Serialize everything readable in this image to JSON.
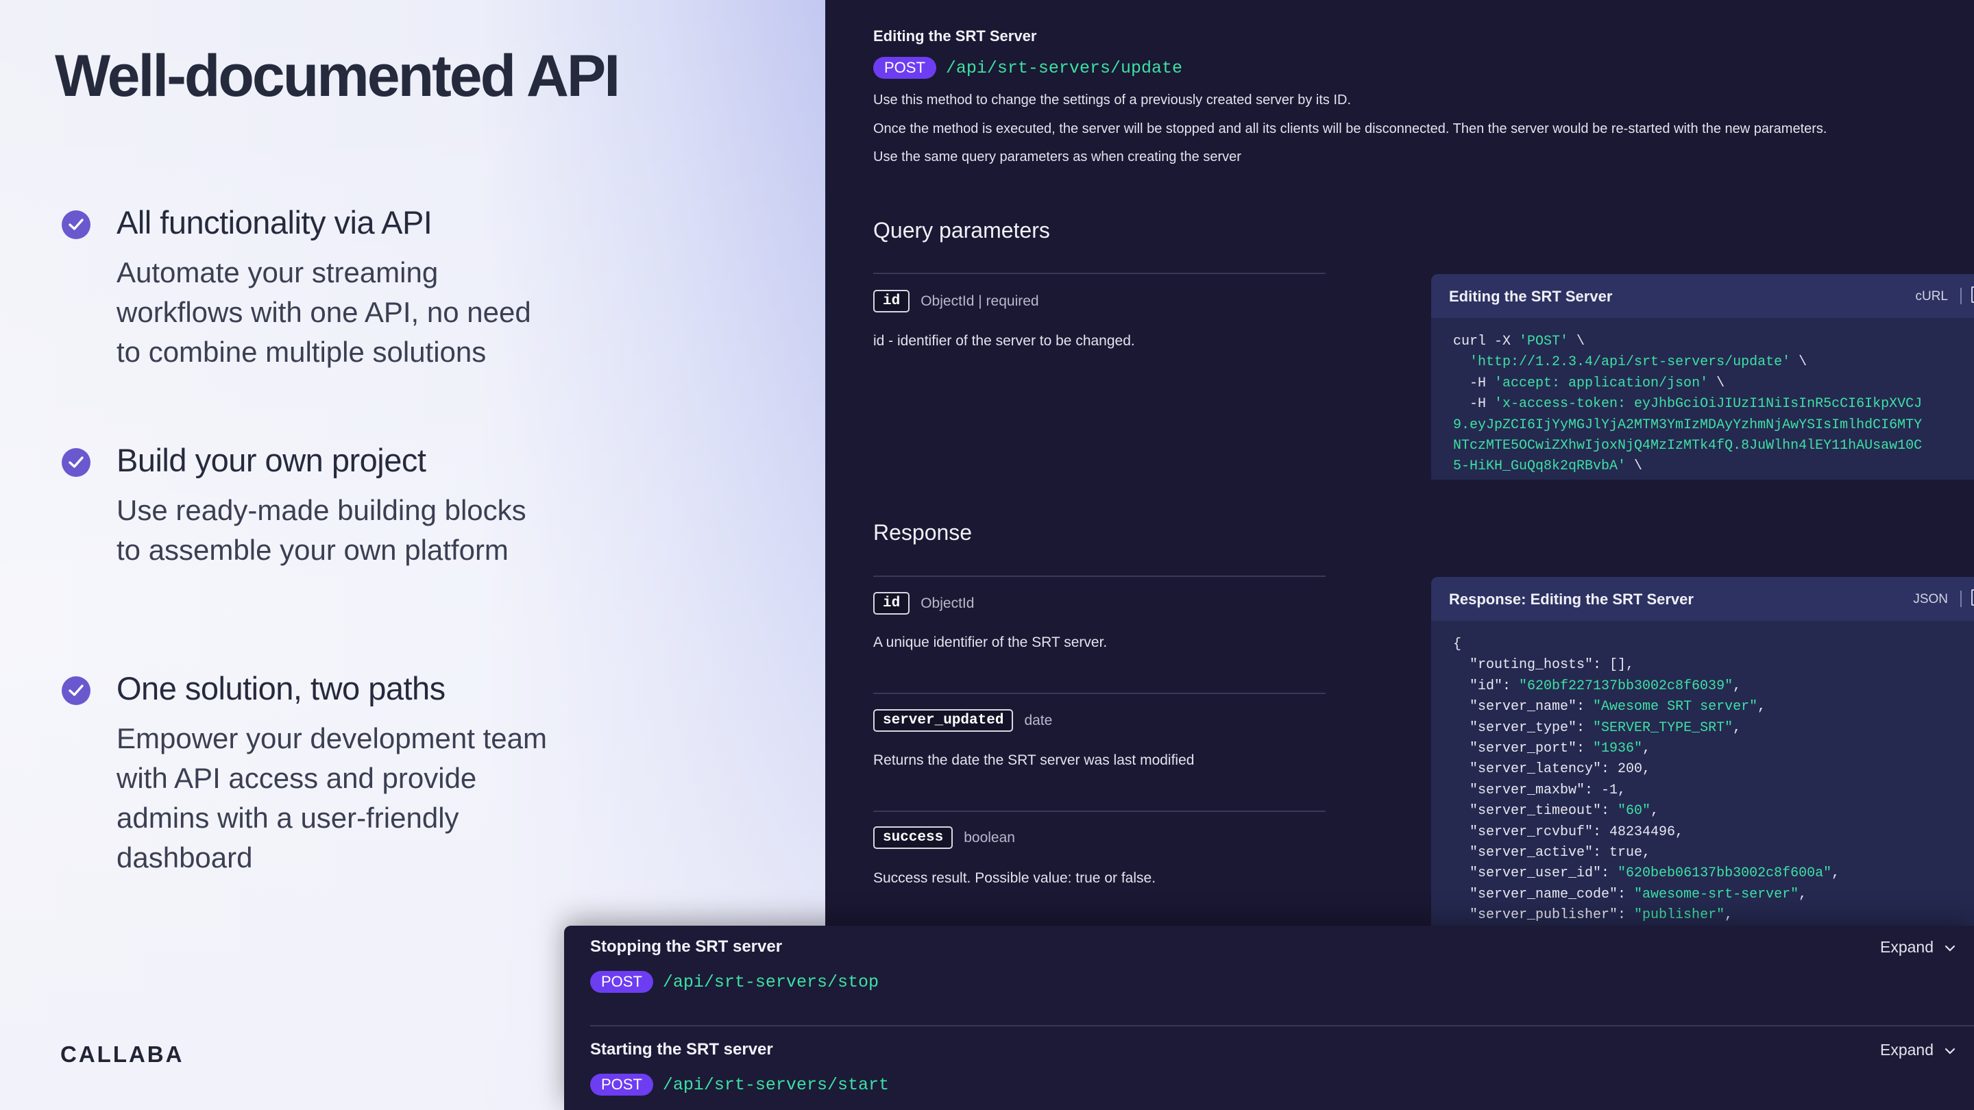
{
  "hero": {
    "title": "Well-documented API"
  },
  "features": [
    {
      "title": "All functionality via API",
      "lines": [
        "Automate your streaming",
        "workflows with one API, no need",
        "to combine multiple solutions"
      ]
    },
    {
      "title": "Build your own project",
      "lines": [
        "Use ready-made building blocks",
        "to assemble your own platform"
      ]
    },
    {
      "title": "One solution, two paths",
      "lines": [
        "Empower your development team",
        "with API access and provide",
        "admins with a user-friendly",
        "dashboard"
      ]
    }
  ],
  "brand": "CALLABA",
  "doc": {
    "title": "Editing the SRT Server",
    "method": "POST",
    "path": "/api/srt-servers/update",
    "paragraphs": [
      "Use this method to change the settings of a previously created server by its ID.",
      "Once the method is executed, the server will be stopped and all its clients will be disconnected. Then the server would be re-started with the new parameters.",
      "Use the same query parameters as when creating the server"
    ],
    "query_heading": "Query parameters",
    "query_params": [
      {
        "name": "id",
        "type": "ObjectId | required",
        "desc": "id - identifier of the server to be changed."
      }
    ],
    "response_heading": "Response",
    "response_params": [
      {
        "name": "id",
        "type": "ObjectId",
        "desc": "A unique identifier of the SRT server."
      },
      {
        "name": "server_updated",
        "type": "date",
        "desc": "Returns the date the SRT server was last modified"
      },
      {
        "name": "success",
        "type": "boolean",
        "desc": "Success result. Possible value: true or false."
      }
    ]
  },
  "curl_panel": {
    "title": "Editing the SRT Server",
    "format": "cURL",
    "lines": [
      {
        "k": "curl -X ",
        "s": "'POST'",
        "t": " \\"
      },
      {
        "k": "  ",
        "s": "'http://1.2.3.4/api/srt-servers/update'",
        "t": " \\"
      },
      {
        "k": "  -H ",
        "s": "'accept: application/json'",
        "t": " \\"
      },
      {
        "k": "  -H ",
        "s": "'x-access-token: eyJhbGciOiJIUzI1NiIsInR5cCI6IkpXVCJ",
        "t": ""
      },
      {
        "k": "",
        "s": "9.eyJpZCI6IjYyMGJlYjA2MTM3YmIzMDAyYzhmNjAwYSIsImlhdCI6MTY",
        "t": ""
      },
      {
        "k": "",
        "s": "NTczMTE5OCwiZXhwIjoxNjQ4MzIzMTk4fQ.8JuWlhn4lEY11hAUsaw10C",
        "t": ""
      },
      {
        "k": "",
        "s": "5-HiKH_GuQq8k2qRBvbA'",
        "t": " \\"
      }
    ]
  },
  "json_panel": {
    "title": "Response: Editing the SRT Server",
    "format": "JSON",
    "lines": [
      {
        "k": "{",
        "s": "",
        "t": ""
      },
      {
        "k": "  \"routing_hosts\": [],",
        "s": "",
        "t": ""
      },
      {
        "k": "  \"id\": ",
        "s": "\"620bf227137bb3002c8f6039\"",
        "t": ","
      },
      {
        "k": "  \"server_name\": ",
        "s": "\"Awesome SRT server\"",
        "t": ","
      },
      {
        "k": "  \"server_type\": ",
        "s": "\"SERVER_TYPE_SRT\"",
        "t": ","
      },
      {
        "k": "  \"server_port\": ",
        "s": "\"1936\"",
        "t": ","
      },
      {
        "k": "  \"server_latency\": 200,",
        "s": "",
        "t": ""
      },
      {
        "k": "  \"server_maxbw\": -1,",
        "s": "",
        "t": ""
      },
      {
        "k": "  \"server_timeout\": ",
        "s": "\"60\"",
        "t": ","
      },
      {
        "k": "  \"server_rcvbuf\": 48234496,",
        "s": "",
        "t": ""
      },
      {
        "k": "  \"server_active\": true,",
        "s": "",
        "t": ""
      },
      {
        "k": "  \"server_user_id\": ",
        "s": "\"620beb06137bb3002c8f600a\"",
        "t": ","
      },
      {
        "k": "  \"server_name_code\": ",
        "s": "\"awesome-srt-server\"",
        "t": ","
      },
      {
        "k": "  \"server_publisher\": ",
        "s": "\"publisher\"",
        "t": ","
      }
    ]
  },
  "endpoints": [
    {
      "title": "Stopping the SRT server",
      "method": "POST",
      "path": "/api/srt-servers/stop",
      "expand": "Expand"
    },
    {
      "title": "Starting the SRT server",
      "method": "POST",
      "path": "/api/srt-servers/start",
      "expand": "Expand"
    }
  ]
}
